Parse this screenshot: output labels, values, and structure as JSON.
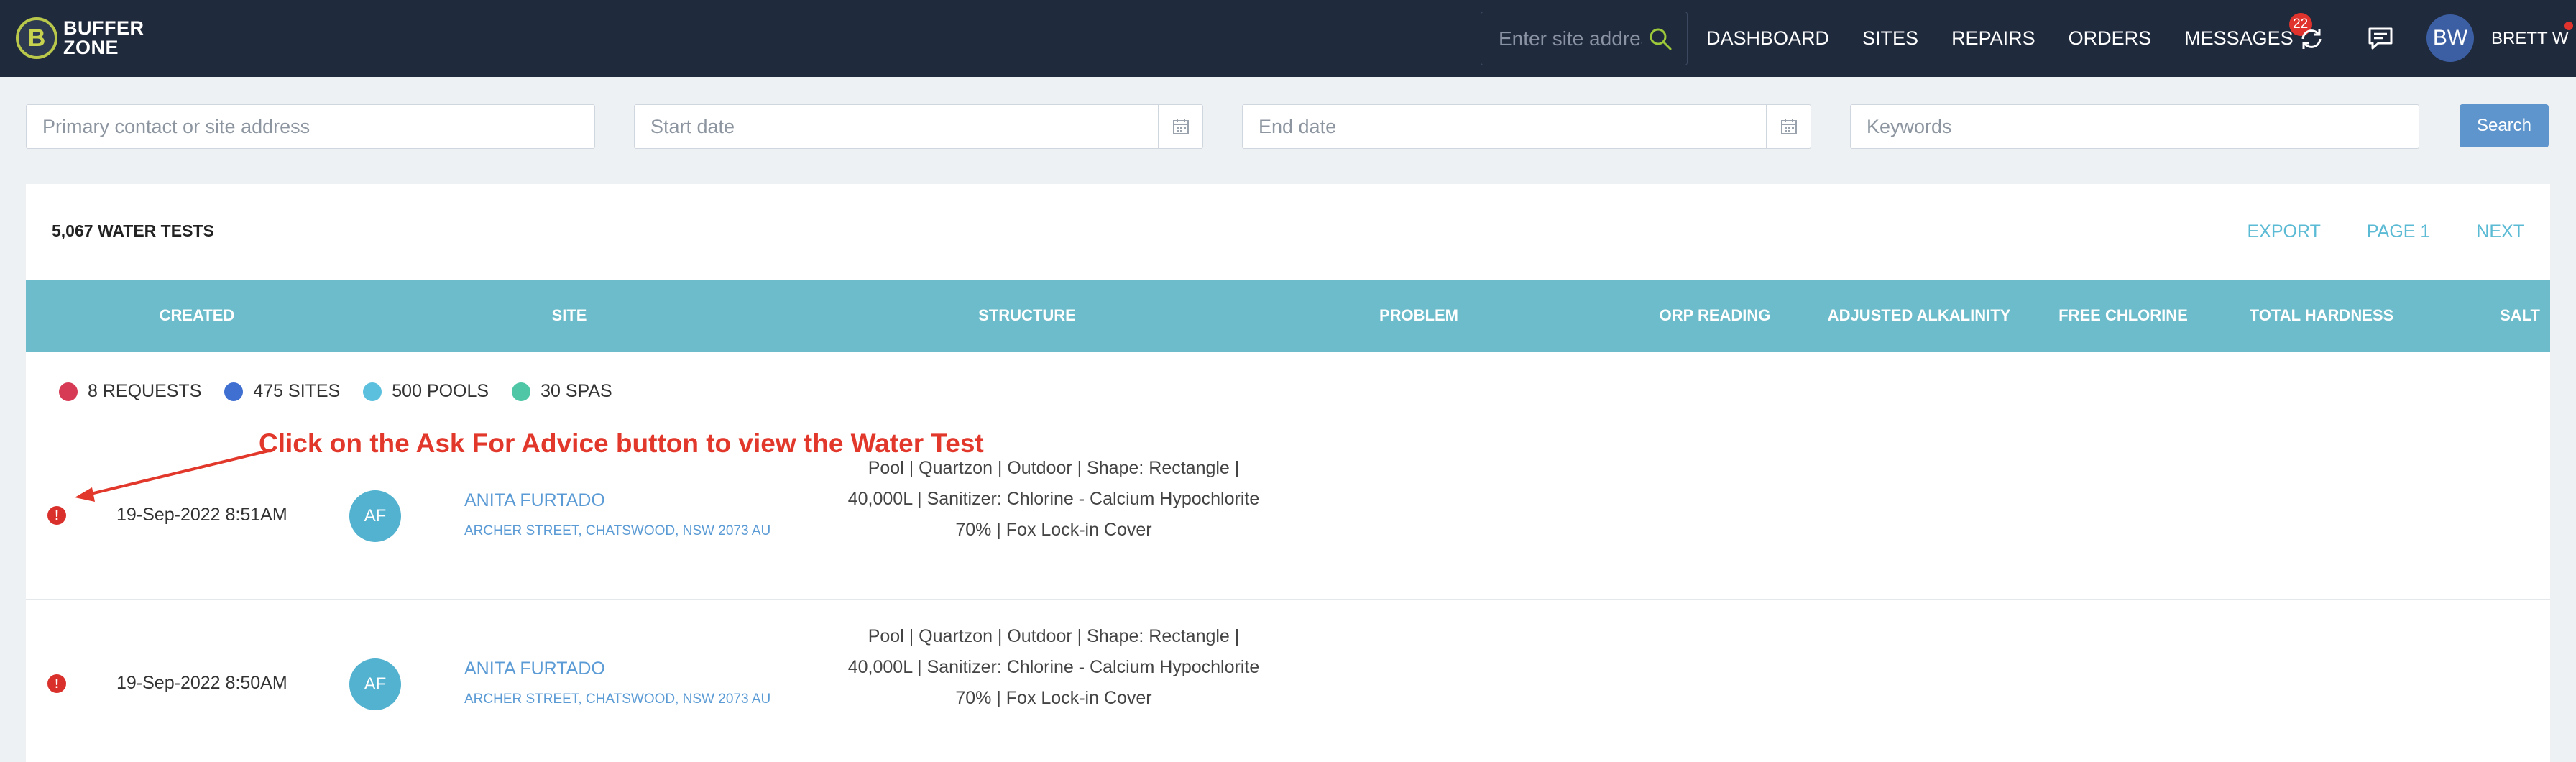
{
  "brand": {
    "name_line1": "BUFFER",
    "name_line2": "ZONE",
    "mark": "B"
  },
  "nav": {
    "search_placeholder": "Enter site address",
    "links": [
      "DASHBOARD",
      "SITES",
      "REPAIRS",
      "ORDERS",
      "MESSAGES"
    ],
    "messages_badge": "22",
    "user_initials": "BW",
    "user_name": "BRETT W"
  },
  "filters": {
    "contact_placeholder": "Primary contact or site address",
    "start_placeholder": "Start date",
    "end_placeholder": "End date",
    "keywords_placeholder": "Keywords",
    "search_label": "Search"
  },
  "card": {
    "title": "5,067 WATER TESTS",
    "export_label": "EXPORT",
    "page_label": "PAGE 1",
    "next_label": "NEXT"
  },
  "columns": [
    "CREATED",
    "SITE",
    "STRUCTURE",
    "PROBLEM",
    "ORP READING",
    "ADJUSTED ALKALINITY",
    "FREE CHLORINE",
    "TOTAL HARDNESS",
    "SALT"
  ],
  "legend": [
    {
      "label": "8 REQUESTS",
      "color": "#d63a55"
    },
    {
      "label": "475 SITES",
      "color": "#3f6fd1"
    },
    {
      "label": "500 POOLS",
      "color": "#5bc0de"
    },
    {
      "label": "30 SPAS",
      "color": "#4fc7a6"
    }
  ],
  "rows": [
    {
      "date": "19-Sep-2022 8:51AM",
      "initials": "AF",
      "name": "ANITA FURTADO",
      "address": "ARCHER STREET, CHATSWOOD, NSW 2073 AU",
      "structure": "Pool | Quartzon | Outdoor | Shape: Rectangle | 40,000L | Sanitizer: Chlorine - Calcium Hypochlorite 70% | Fox Lock-in Cover"
    },
    {
      "date": "19-Sep-2022 8:50AM",
      "initials": "AF",
      "name": "ANITA FURTADO",
      "address": "ARCHER STREET, CHATSWOOD, NSW 2073 AU",
      "structure": "Pool | Quartzon | Outdoor | Shape: Rectangle | 40,000L | Sanitizer: Chlorine - Calcium Hypochlorite 70% | Fox Lock-in Cover"
    }
  ],
  "annotation": "Click on the Ask For Advice button to view the Water Test",
  "colors": {
    "nav_bg": "#1f2a3c",
    "header_bg": "#6dbccb",
    "link": "#5b9bd5",
    "alert": "#d9302b",
    "annotation": "#e2372b"
  }
}
